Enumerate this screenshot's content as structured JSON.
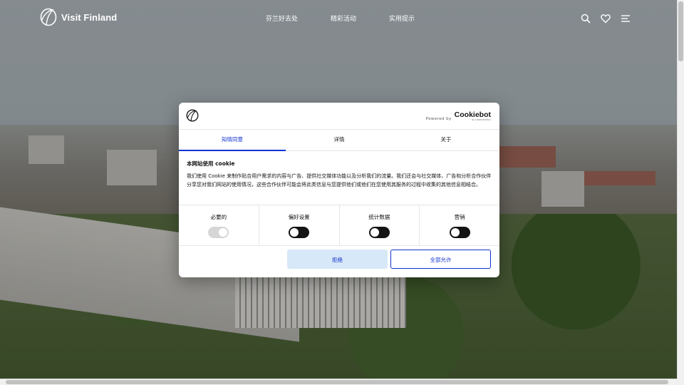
{
  "brand": {
    "name": "Visit Finland"
  },
  "nav": {
    "items": [
      "芬兰好去处",
      "精彩活动",
      "实用提示"
    ]
  },
  "header_icons": [
    "search-icon",
    "heart-icon",
    "menu-icon"
  ],
  "cookie_dialog": {
    "powered_by": "Powered by",
    "provider": "Cookiebot",
    "provider_sub": "by Usercentrics",
    "tabs": [
      "知情同意",
      "详情",
      "关于"
    ],
    "active_tab": "知情同意",
    "heading": "本网站使用 cookie",
    "text": "我们使用 Cookie 来制作贴合用户需求的内容与广告、提供社交媒体功能以及分析我们的流量。我们还会与社交媒体、广告和分析合作伙伴分享您对我们网站的使用情况，这些合作伙伴可能会将此类信息与您提供他们或他们在您使用其服务的过程中收集的其他信息相结合。",
    "toggles": [
      {
        "label": "必要的",
        "state": "on",
        "disabled": true
      },
      {
        "label": "偏好设置",
        "state": "off",
        "disabled": false
      },
      {
        "label": "统计数据",
        "state": "off",
        "disabled": false
      },
      {
        "label": "营销",
        "state": "off",
        "disabled": false
      }
    ],
    "reject_label": "拒绝",
    "accept_all_label": "全部允许"
  },
  "colors": {
    "accent": "#1032cf",
    "reject_bg": "#d7e8f8",
    "toggle_on": "#141414",
    "toggle_disabled": "#d6d6d6"
  }
}
